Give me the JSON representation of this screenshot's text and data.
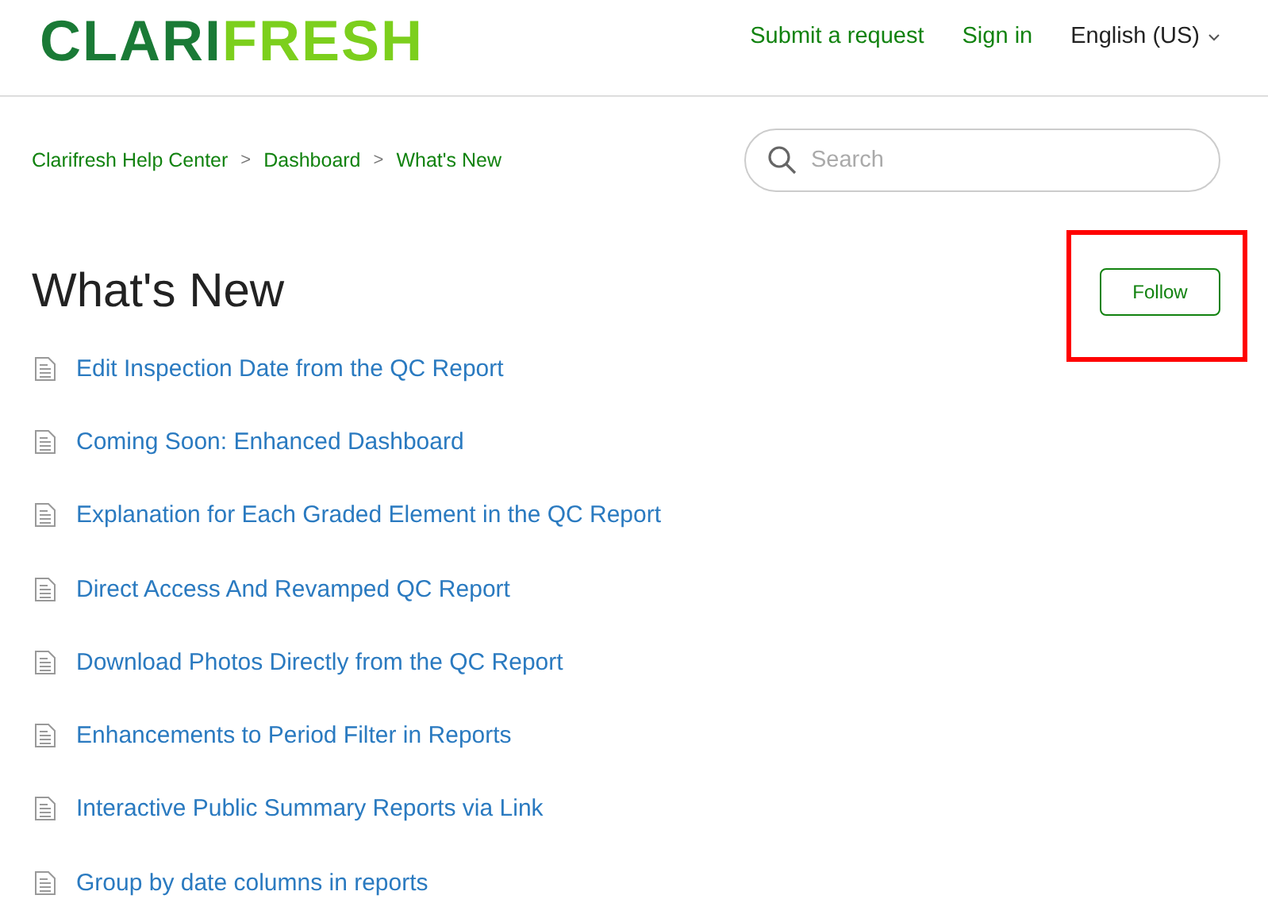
{
  "header": {
    "logo": {
      "part_1": "CLARI",
      "part_2": "FRESH"
    },
    "nav": [
      "Submit a request",
      "Sign in"
    ],
    "language": "English (US)"
  },
  "breadcrumb": [
    {
      "kind": "link",
      "text": "Clarifresh Help Center"
    },
    {
      "kind": "separator",
      "text": ">"
    },
    {
      "kind": "link",
      "text": "Dashboard"
    },
    {
      "kind": "separator",
      "text": ">"
    },
    {
      "kind": "link",
      "text": "What's New"
    }
  ],
  "search": {
    "placeholder": "Search"
  },
  "page_title": "What's New",
  "follow_button": {
    "label": "Follow",
    "highlighted": true
  },
  "articles": [
    "Edit Inspection Date from the QC Report",
    "Coming Soon: Enhanced Dashboard",
    "Explanation for Each Graded Element in the QC Report",
    "Direct Access And Revamped QC Report",
    "Download Photos Directly from the QC Report",
    "Enhancements to Period Filter in Reports",
    "Interactive Public Summary Reports via Link",
    "Group by date columns in reports"
  ]
}
